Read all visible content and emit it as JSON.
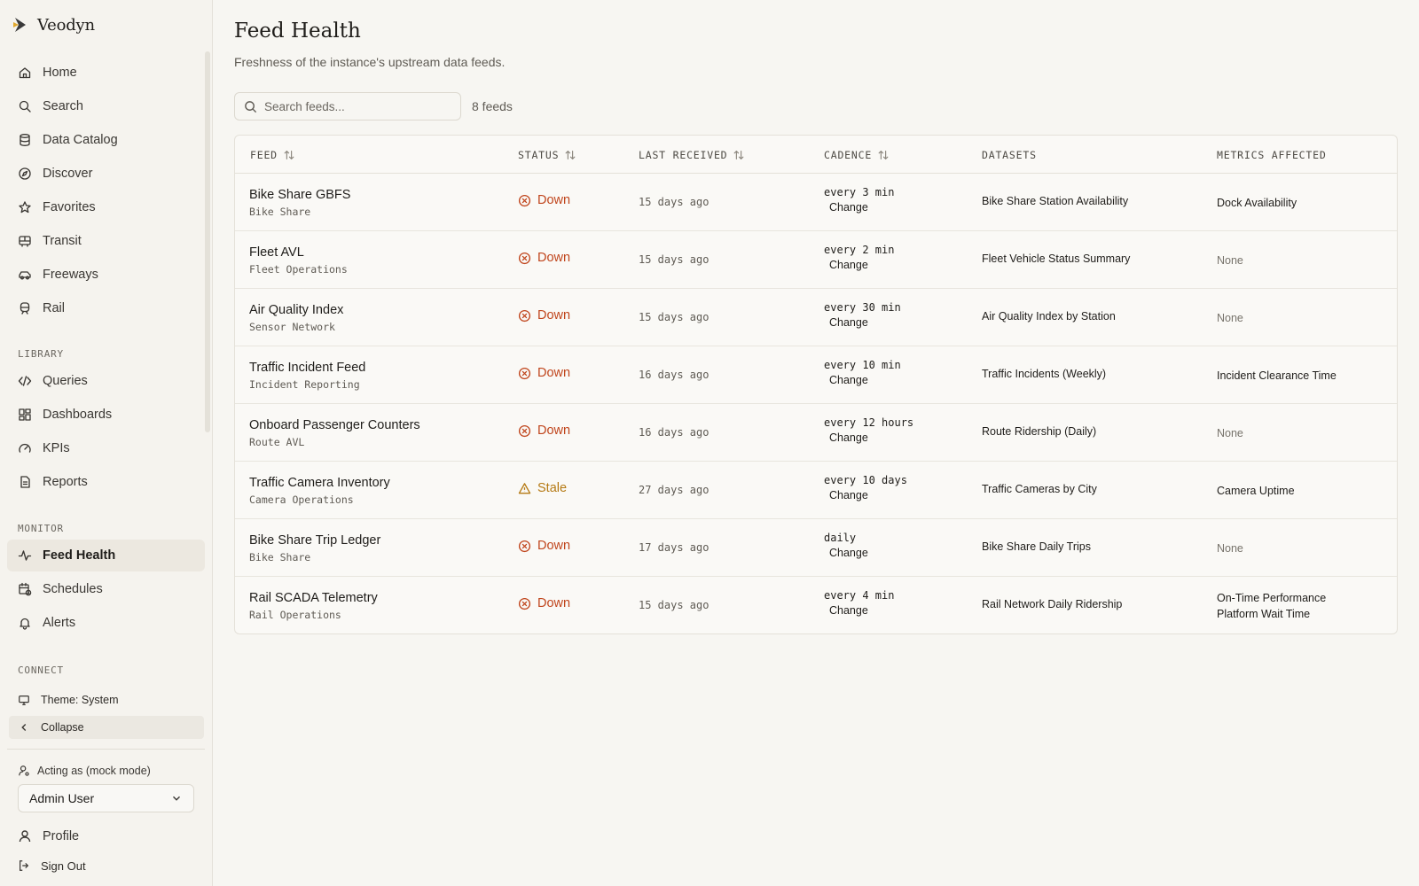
{
  "app": {
    "name": "Veodyn"
  },
  "nav": {
    "main": [
      {
        "label": "Home",
        "icon": "home-icon"
      },
      {
        "label": "Search",
        "icon": "search-icon"
      },
      {
        "label": "Data Catalog",
        "icon": "database-icon"
      },
      {
        "label": "Discover",
        "icon": "compass-icon"
      },
      {
        "label": "Favorites",
        "icon": "star-icon"
      },
      {
        "label": "Transit",
        "icon": "bus-icon"
      },
      {
        "label": "Freeways",
        "icon": "car-icon"
      },
      {
        "label": "Rail",
        "icon": "train-icon"
      }
    ],
    "library_label": "LIBRARY",
    "library": [
      {
        "label": "Queries",
        "icon": "code-icon"
      },
      {
        "label": "Dashboards",
        "icon": "dashboard-icon"
      },
      {
        "label": "KPIs",
        "icon": "gauge-icon"
      },
      {
        "label": "Reports",
        "icon": "file-icon"
      }
    ],
    "monitor_label": "MONITOR",
    "monitor": [
      {
        "label": "Feed Health",
        "icon": "activity-icon",
        "active": true
      },
      {
        "label": "Schedules",
        "icon": "calendar-clock-icon"
      },
      {
        "label": "Alerts",
        "icon": "bell-icon"
      }
    ],
    "connect_label": "CONNECT",
    "theme_label": "Theme: System",
    "collapse_label": "Collapse",
    "acting_label": "Acting as (mock mode)",
    "acting_user": "Admin User",
    "profile_label": "Profile",
    "signout_label": "Sign Out"
  },
  "page": {
    "title": "Feed Health",
    "subtitle": "Freshness of the instance's upstream data feeds.",
    "search_placeholder": "Search feeds...",
    "count": "8 feeds"
  },
  "table": {
    "columns": [
      "FEED",
      "STATUS",
      "LAST RECEIVED",
      "CADENCE",
      "DATASETS",
      "METRICS AFFECTED"
    ],
    "change_label": "Change",
    "rows": [
      {
        "feed": "Bike Share GBFS",
        "owner": "Bike Share",
        "status": "Down",
        "last": "15 days ago",
        "cadence": "every 3 min",
        "dataset": "Bike Share Station Availability",
        "metrics": [
          "Dock Availability"
        ]
      },
      {
        "feed": "Fleet AVL",
        "owner": "Fleet Operations",
        "status": "Down",
        "last": "15 days ago",
        "cadence": "every 2 min",
        "dataset": "Fleet Vehicle Status Summary",
        "metrics": [
          "None"
        ]
      },
      {
        "feed": "Air Quality Index",
        "owner": "Sensor Network",
        "status": "Down",
        "last": "15 days ago",
        "cadence": "every 30 min",
        "dataset": "Air Quality Index by Station",
        "metrics": [
          "None"
        ]
      },
      {
        "feed": "Traffic Incident Feed",
        "owner": "Incident Reporting",
        "status": "Down",
        "last": "16 days ago",
        "cadence": "every 10 min",
        "dataset": "Traffic Incidents (Weekly)",
        "metrics": [
          "Incident Clearance Time"
        ]
      },
      {
        "feed": "Onboard Passenger Counters",
        "owner": "Route AVL",
        "status": "Down",
        "last": "16 days ago",
        "cadence": "every 12 hours",
        "dataset": "Route Ridership (Daily)",
        "metrics": [
          "None"
        ]
      },
      {
        "feed": "Traffic Camera Inventory",
        "owner": "Camera Operations",
        "status": "Stale",
        "last": "27 days ago",
        "cadence": "every 10 days",
        "dataset": "Traffic Cameras by City",
        "metrics": [
          "Camera Uptime"
        ]
      },
      {
        "feed": "Bike Share Trip Ledger",
        "owner": "Bike Share",
        "status": "Down",
        "last": "17 days ago",
        "cadence": "daily",
        "dataset": "Bike Share Daily Trips",
        "metrics": [
          "None"
        ]
      },
      {
        "feed": "Rail SCADA Telemetry",
        "owner": "Rail Operations",
        "status": "Down",
        "last": "15 days ago",
        "cadence": "every 4 min",
        "dataset": "Rail Network Daily Ridership",
        "metrics": [
          "On-Time Performance",
          "Platform Wait Time"
        ]
      }
    ]
  },
  "colors": {
    "down": "#c0451c",
    "stale": "#b57a14",
    "active_bg": "#ece8e0"
  }
}
